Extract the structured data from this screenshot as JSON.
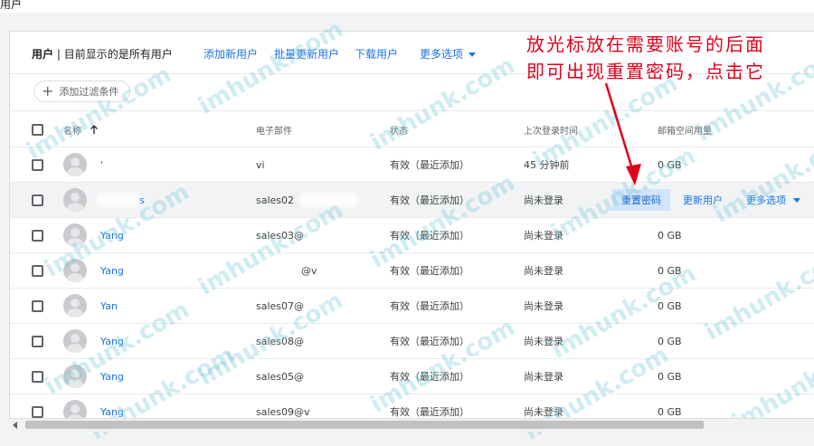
{
  "page": {
    "top_label": "用户"
  },
  "toolbar": {
    "title_bold": "用户",
    "title_rest": " | 目前显示的是所有用户",
    "add_user": "添加新用户",
    "bulk_update": "批量更新用户",
    "download": "下载用户",
    "more": "更多选项"
  },
  "filter": {
    "add_filter": "添加过滤条件"
  },
  "columns": {
    "name": "名称",
    "sort_icon": "arrow-up-icon",
    "email": "电子部件",
    "status": "状态",
    "last_login": "上次登录时间",
    "storage": "邮箱空间用量"
  },
  "rows": [
    {
      "name": "'",
      "email": "vi",
      "status": "有效（最近添加）",
      "last_login": "45 分钟前",
      "storage": "0 GB"
    },
    {
      "name": "s",
      "email": "sales02",
      "status": "有效（最近添加）",
      "last_login": "尚未登录",
      "storage": ""
    },
    {
      "name": "Yang",
      "email": "sales03@",
      "status": "有效（最近添加）",
      "last_login": "尚未登录",
      "storage": "0 GB"
    },
    {
      "name": "Yang",
      "email": "@v",
      "status": "有效（最近添加）",
      "last_login": "尚未登录",
      "storage": "0 GB"
    },
    {
      "name": "Yan",
      "email": "sales07@",
      "status": "有效（最近添加）",
      "last_login": "尚未登录",
      "storage": "0 GB"
    },
    {
      "name": "Yang",
      "email": "sales08@",
      "status": "有效（最近添加）",
      "last_login": "尚未登录",
      "storage": "0 GB"
    },
    {
      "name": "Yang",
      "email": "sales05@",
      "status": "有效（最近添加）",
      "last_login": "尚未登录",
      "storage": "0 GB"
    },
    {
      "name": "Yang",
      "email": "sales09@v",
      "status": "有效（最近添加）",
      "last_login": "尚未登录",
      "storage": "0 GB"
    }
  ],
  "row_actions": {
    "reset_password": "重置密码",
    "update_user": "更新用户",
    "more": "更多选项"
  },
  "annotation": {
    "line1": "放光标放在需要账号的后面",
    "line2": "即可出现重置密码，点击它",
    "color": "#e0001b"
  },
  "watermark": "imhunk.com",
  "colors": {
    "link": "#1a73e8",
    "hover_row": "#f1f3f4",
    "reset_button_bg": "#d2e3fc"
  }
}
